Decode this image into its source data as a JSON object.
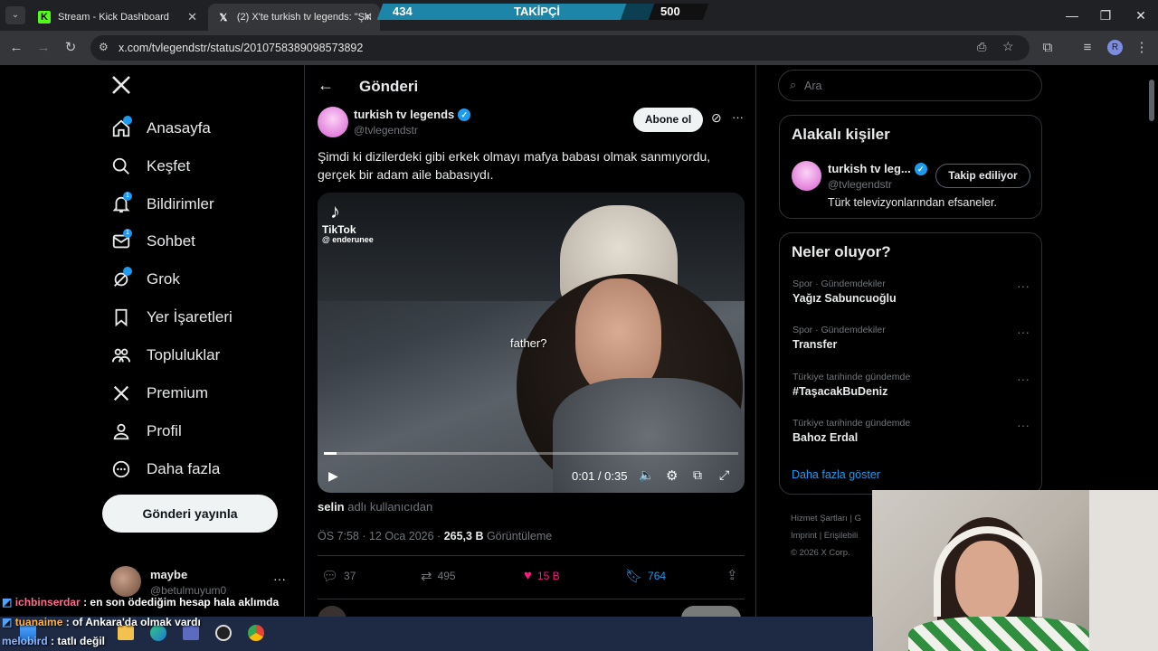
{
  "browser": {
    "tabs": [
      {
        "title": "Stream - Kick Dashboard",
        "icon": "kick-icon"
      },
      {
        "title": "(2) X'te turkish tv legends: \"Şim",
        "icon": "x-logo-icon"
      }
    ],
    "url": "x.com/tvlegendstr/status/2010758389098573892",
    "profile_initial": "R"
  },
  "follower_overlay": {
    "current": "434",
    "label": "TAKİPÇİ",
    "goal": "500",
    "progress": 0.868
  },
  "nav": {
    "items": [
      {
        "label": "Anasayfa",
        "icon": "home-icon"
      },
      {
        "label": "Keşfet",
        "icon": "search-icon"
      },
      {
        "label": "Bildirimler",
        "icon": "bell-icon",
        "badge": "1"
      },
      {
        "label": "Sohbet",
        "icon": "mail-icon",
        "badge": "1"
      },
      {
        "label": "Grok",
        "icon": "grok-icon"
      },
      {
        "label": "Yer İşaretleri",
        "icon": "bookmark-icon"
      },
      {
        "label": "Topluluklar",
        "icon": "communities-icon"
      },
      {
        "label": "Premium",
        "icon": "x-premium-icon"
      },
      {
        "label": "Profil",
        "icon": "person-icon"
      },
      {
        "label": "Daha fazla",
        "icon": "more-circle-icon"
      }
    ],
    "post_button": "Gönderi yayınla",
    "account": {
      "name": "maybe",
      "handle": "@betulmuyum0"
    }
  },
  "post": {
    "header_title": "Gönderi",
    "author_name": "turkish tv legends",
    "author_handle": "@tvlegendstr",
    "subscribe_label": "Abone ol",
    "text": "Şimdi ki dizilerdeki gibi erkek olmayı mafya babası olmak sanmıyordu, gerçek bir adam aile babasıydı.",
    "video": {
      "watermark": "TikTok",
      "watermark_user": "@ enderunee",
      "subtitle": "father?",
      "time": "0:01 / 0:35",
      "progress": 0.03
    },
    "from_user": "selin",
    "from_suffix": "adlı kullanıcıdan",
    "meta_time": "ÖS 7:58 · 12 Oca 2026 ·",
    "views_count": "265,3 B",
    "views_label": "Görüntüleme",
    "stats": {
      "replies": "37",
      "reposts": "495",
      "likes": "15 B",
      "bookmarks": "764"
    }
  },
  "sidebar": {
    "search_placeholder": "Ara",
    "related_title": "Alakalı kişiler",
    "related": {
      "name": "turkish tv leg...",
      "handle": "@tvlegendstr",
      "bio": "Türk televizyonlarından efsaneler.",
      "button": "Takip ediliyor"
    },
    "trends_title": "Neler oluyor?",
    "trends": [
      {
        "category": "Spor · Gündemdekiler",
        "name": "Yağız Sabuncuoğlu"
      },
      {
        "category": "Spor · Gündemdekiler",
        "name": "Transfer"
      },
      {
        "category": "Türkiye tarihinde gündemde",
        "name": "#TaşacakBuDeniz"
      },
      {
        "category": "Türkiye tarihinde gündemde",
        "name": "Bahoz Erdal"
      }
    ],
    "show_more": "Daha fazla göster",
    "footer": [
      "Hizmet Şartları",
      "|",
      "G",
      "Imprint",
      "|",
      "Erişilebili",
      "© 2026 X Corp."
    ]
  },
  "chat": [
    {
      "user": "ichbinserdar",
      "message": ": en son ödediğim hesap hala aklımda",
      "color": "#ff6b8a"
    },
    {
      "user": "tuanaime",
      "message": ": of Ankara'da olmak vardı",
      "color": "#ffb347"
    },
    {
      "user": "melobird",
      "message": ": tatlı değil",
      "color": "#8ab4ff"
    }
  ]
}
